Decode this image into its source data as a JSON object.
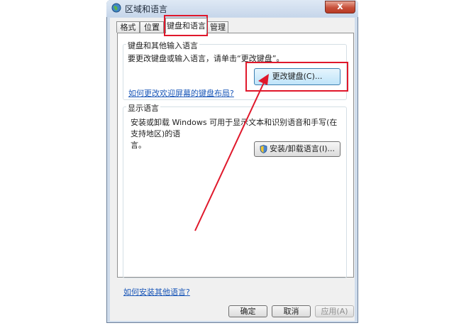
{
  "window": {
    "title": "区域和语言",
    "close_label": "x"
  },
  "tabs": {
    "formats": "格式",
    "location": "位置",
    "keyboards": "键盘和语言",
    "admin": "管理"
  },
  "keyboards_group": {
    "title": "键盘和其他输入语言",
    "desc": "要更改键盘或输入语言，请单击“更改键盘”。",
    "button": "更改键盘(C)...",
    "link": "如何更改欢迎屏幕的键盘布局?"
  },
  "display_group": {
    "title": "显示语言",
    "desc_line1": "安装或卸载 Windows 可用于显示文本和识别语音和手写(在支持地区)的语",
    "desc_line2": "言。",
    "button": "安装/卸载语言(I)..."
  },
  "bottom_link": "如何安装其他语言?",
  "footer": {
    "ok": "确定",
    "cancel": "取消",
    "apply": "应用(A)"
  },
  "colors": {
    "annotation": "#e0182b"
  },
  "icons": {
    "title": "globe-icon",
    "install": "shield-icon"
  }
}
